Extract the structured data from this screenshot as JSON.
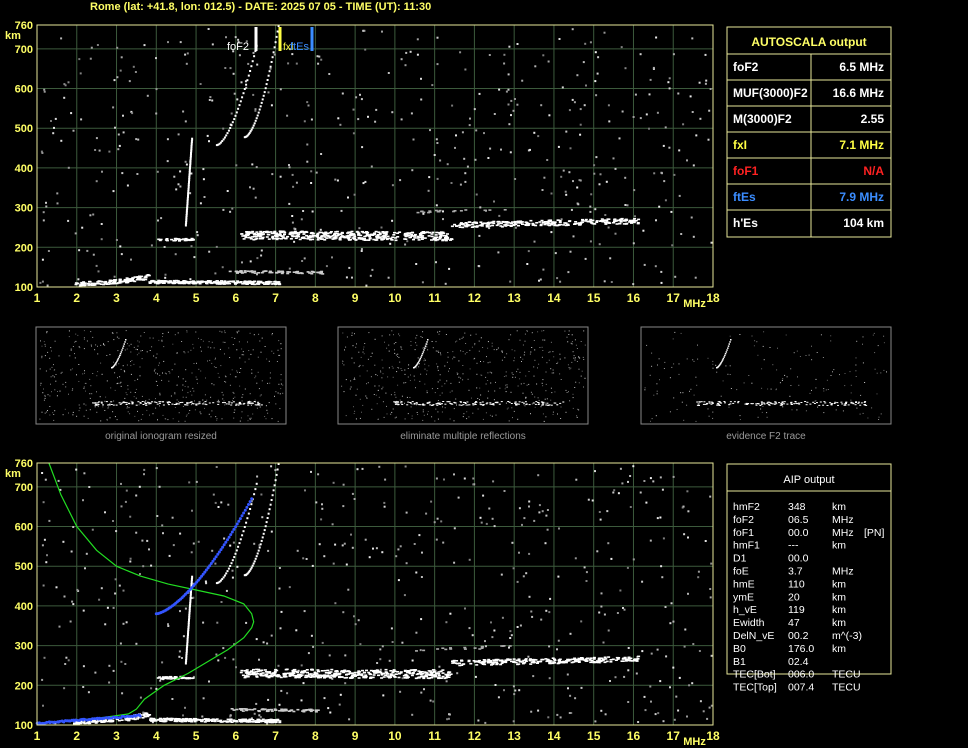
{
  "header": "Rome (lat: +41.8, lon: 012.5) - DATE: 2025 07 05 - TIME (UT): 11:30",
  "colors": {
    "background": "#000000",
    "frame": "#e8e89a",
    "grid": "#3c5a3c",
    "text_yellow": "#ffff66",
    "trace": "#ffffff",
    "aip_profile": "#22dd22",
    "aip_points": "#3355ff",
    "foF1": "#ff2222",
    "ftEs": "#3b8dff",
    "fxI": "#ffff44"
  },
  "axis": {
    "x_ticks": [
      "1",
      "2",
      "3",
      "4",
      "5",
      "6",
      "7",
      "8",
      "9",
      "10",
      "11",
      "12",
      "13",
      "14",
      "15",
      "16",
      "17",
      "18"
    ],
    "x_unit": "MHz",
    "y_ticks": [
      "100",
      "200",
      "300",
      "400",
      "500",
      "600",
      "700",
      "760"
    ],
    "y_unit": "km",
    "xlim": [
      1,
      18
    ],
    "ylim": [
      100,
      760
    ]
  },
  "top_markers": {
    "foF2": "foF2",
    "fxI": "fxI",
    "ftEs": "ftEs"
  },
  "autoscala": {
    "title": "AUTOSCALA output",
    "rows": [
      {
        "label": "foF2",
        "value": "6.5 MHz",
        "color": "#ffffff"
      },
      {
        "label": "MUF(3000)F2",
        "value": "16.6 MHz",
        "color": "#ffffff"
      },
      {
        "label": "M(3000)F2",
        "value": "2.55",
        "color": "#ffffff"
      },
      {
        "label": "fxI",
        "value": "7.1 MHz",
        "color": "#ffff44"
      },
      {
        "label": "foF1",
        "value": "N/A",
        "color": "#ff2222"
      },
      {
        "label": "ftEs",
        "value": "7.9 MHz",
        "color": "#3b8dff"
      },
      {
        "label": "h'Es",
        "value": "104    km",
        "color": "#ffffff"
      }
    ]
  },
  "thumbnails": [
    {
      "caption": "original ionogram resized"
    },
    {
      "caption": "eliminate multiple reflections"
    },
    {
      "caption": "evidence F2 trace"
    }
  ],
  "aip": {
    "title": "AIP output",
    "rows": [
      [
        "hmF2",
        "348",
        "km",
        ""
      ],
      [
        "foF2",
        "06.5",
        "MHz",
        ""
      ],
      [
        "foF1",
        "00.0",
        "MHz",
        "[PN]"
      ],
      [
        "hmF1",
        "---",
        "km",
        ""
      ],
      [
        "D1",
        "00.0",
        "",
        ""
      ],
      [
        "foE",
        "3.7",
        "MHz",
        ""
      ],
      [
        "hmE",
        "110",
        "km",
        ""
      ],
      [
        "ymE",
        "20",
        "km",
        ""
      ],
      [
        "h_vE",
        "119",
        "km",
        ""
      ],
      [
        "Ewidth",
        "47",
        "km",
        ""
      ],
      [
        "DelN_vE",
        "00.2",
        "m^(-3)",
        ""
      ],
      [
        "B0",
        "176.0",
        "km",
        ""
      ],
      [
        "B1",
        "02.4",
        "",
        ""
      ],
      [
        "TEC[Bot]",
        "006.0",
        "TECU",
        ""
      ],
      [
        "TEC[Top]",
        "007.4",
        "TECU",
        ""
      ]
    ]
  },
  "chart_data": [
    {
      "type": "scatter",
      "title": "",
      "xlabel": "MHz",
      "ylabel": "km",
      "xlim": [
        1,
        18
      ],
      "ylim": [
        100,
        760
      ],
      "grid": true,
      "series": [
        {
          "name": "foF2",
          "points": [
            [
              6.5,
              700
            ]
          ]
        },
        {
          "name": "fxI",
          "points": [
            [
              7.1,
              700
            ]
          ]
        },
        {
          "name": "ftEs",
          "points": [
            [
              7.9,
              700
            ]
          ]
        }
      ]
    },
    {
      "type": "line",
      "title": "AIP output",
      "xlabel": "MHz",
      "ylabel": "km",
      "xlim": [
        1,
        18
      ],
      "ylim": [
        100,
        760
      ],
      "grid": true,
      "profile_x": [
        1.0,
        1.8,
        2.6,
        3.3,
        3.5,
        3.7,
        4.2,
        4.8,
        5.3,
        5.8,
        6.2,
        6.4,
        6.45,
        6.4,
        6.2,
        5.7,
        5.0,
        4.3,
        3.6,
        3.0,
        2.5,
        2.0,
        1.6,
        1.3
      ],
      "profile_h": [
        104,
        110,
        118,
        128,
        140,
        165,
        200,
        230,
        260,
        290,
        320,
        345,
        360,
        380,
        405,
        425,
        440,
        455,
        475,
        500,
        540,
        600,
        680,
        760
      ]
    }
  ]
}
